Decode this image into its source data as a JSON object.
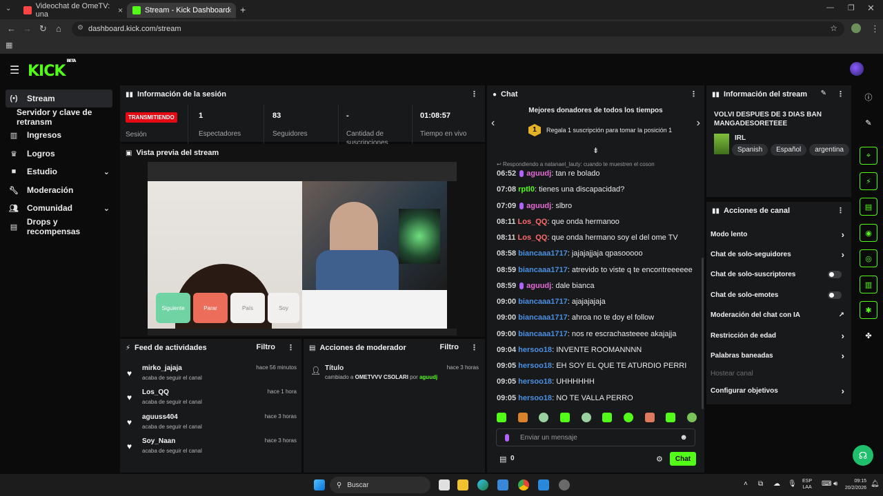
{
  "browser": {
    "tabs": [
      {
        "title": "Videochat de OmeTV: una",
        "active": false
      },
      {
        "title": "Stream - Kick Dashboard",
        "active": true
      }
    ],
    "new_tab_glyph": "+",
    "url": "dashboard.kick.com/stream"
  },
  "kick": {
    "logo": "KICK",
    "logo_badge": "BETA"
  },
  "sidebar": {
    "items": [
      {
        "label": "Stream",
        "icon": "broadcast-icon"
      },
      {
        "label": "Servidor y clave de retransm"
      },
      {
        "label": "Ingresos",
        "icon": "chart-icon"
      },
      {
        "label": "Logros",
        "icon": "trophy-icon"
      },
      {
        "label": "Estudio",
        "icon": "camera-icon"
      },
      {
        "label": "Moderación",
        "icon": "wrench-icon"
      },
      {
        "label": "Comunidad",
        "icon": "people-icon"
      },
      {
        "label": "Drops y recompensas",
        "icon": "gift-icon"
      }
    ]
  },
  "session": {
    "title": "Información de la sesión",
    "status_badge": "TRANSMITIENDO",
    "status_label": "Sesión",
    "viewers_value": "1",
    "viewers_label": "Espectadores",
    "followers_value": "83",
    "followers_label": "Seguidores",
    "subs_value": "-",
    "subs_label": "Cantidad de suscripciones",
    "live_value": "01:08:57",
    "live_label": "Tiempo en vivo"
  },
  "preview": {
    "title": "Vista previa del stream",
    "btn_next": "Siguiente",
    "btn_stop": "Parar",
    "btn_country": "País",
    "btn_soy": "Soy"
  },
  "feed": {
    "title": "Feed de actividades",
    "filter": "Filtro",
    "items": [
      {
        "name": "mirko_jajaja",
        "sub": "acaba de seguir el canal",
        "time": "hace 56 minutos"
      },
      {
        "name": "Los_QQ",
        "sub": "acaba de seguir el canal",
        "time": "hace 1 hora"
      },
      {
        "name": "aguuss404",
        "sub": "acaba de seguir el canal",
        "time": "hace 3 horas"
      },
      {
        "name": "Soy_Naan",
        "sub": "acaba de seguir el canal",
        "time": "hace 3 horas"
      }
    ]
  },
  "modactions": {
    "title": "Acciones de moderador",
    "filter": "Filtro",
    "item_title": "Título",
    "item_time": "hace 3 horas",
    "item_prefix": "cambiado a",
    "item_value": "OMETVVV CSOLARI",
    "item_by": "por",
    "item_user": "aguudj"
  },
  "chat": {
    "title": "Chat",
    "donors_title": "Mejores donadores de todos los tiempos",
    "donor_rank": "1",
    "donor_text": "Regala 1 suscripción para tomar la posición 1",
    "reply_text": "Respondiendo a natanael_lauty: cuando te muestren el coson",
    "messages": [
      {
        "time": "06:52",
        "user": "aguudj",
        "color": "#e36bd6",
        "mic": true,
        "text": "tan re bolado"
      },
      {
        "time": "07:08",
        "user": "rptl0",
        "color": "#53fc18",
        "mic": false,
        "text": "tienes una discapacidad?"
      },
      {
        "time": "07:09",
        "user": "aguudj",
        "color": "#e36bd6",
        "mic": true,
        "text": "slbro"
      },
      {
        "time": "08:11",
        "user": "Los_QQ",
        "color": "#ff6b6b",
        "mic": false,
        "text": "que onda hermanoo"
      },
      {
        "time": "08:11",
        "user": "Los_QQ",
        "color": "#ff6b6b",
        "mic": false,
        "text": "que onda hermano soy el del ome TV"
      },
      {
        "time": "08:58",
        "user": "biancaaa1717",
        "color": "#4a90e2",
        "mic": false,
        "text": "jajajajjaja qpasooooo"
      },
      {
        "time": "08:59",
        "user": "biancaaa1717",
        "color": "#4a90e2",
        "mic": false,
        "text": "atrevido to viste q te encontreeeeee"
      },
      {
        "time": "08:59",
        "user": "aguudj",
        "color": "#e36bd6",
        "mic": true,
        "text": "dale bianca"
      },
      {
        "time": "09:00",
        "user": "biancaaa1717",
        "color": "#4a90e2",
        "mic": false,
        "text": "ajajajajaja"
      },
      {
        "time": "09:00",
        "user": "biancaaa1717",
        "color": "#4a90e2",
        "mic": false,
        "text": "ahroa no te doy el follow"
      },
      {
        "time": "09:00",
        "user": "biancaaa1717",
        "color": "#4a90e2",
        "mic": false,
        "text": "nos re escrachasteeee akajajja"
      },
      {
        "time": "09:04",
        "user": "hersoo18",
        "color": "#4a90e2",
        "mic": false,
        "text": "INVENTE ROOMANNNN"
      },
      {
        "time": "09:05",
        "user": "hersoo18",
        "color": "#4a90e2",
        "mic": false,
        "text": "EH SOY EL QUE TE ATURDIO PERRI"
      },
      {
        "time": "09:05",
        "user": "hersoo18",
        "color": "#4a90e2",
        "mic": false,
        "text": "UHHHHHH"
      },
      {
        "time": "09:05",
        "user": "hersoo18",
        "color": "#4a90e2",
        "mic": false,
        "text": "NO TE VALLA PERRO"
      }
    ],
    "input_placeholder": "Enviar un mensaje",
    "points": "0",
    "send_label": "Chat"
  },
  "streaminfo": {
    "title": "Información del stream",
    "stream_title": "VOLVI DESPUES DE 3 DIAS BAN MANGADESORETEEE",
    "category": "IRL",
    "tags": [
      "Spanish",
      "Español",
      "argentina"
    ]
  },
  "channel_actions": {
    "title": "Acciones de canal",
    "items": [
      {
        "label": "Modo lento",
        "control": "arrow"
      },
      {
        "label": "Chat de solo-seguidores",
        "control": "arrow"
      },
      {
        "label": "Chat de solo-suscriptores",
        "control": "toggle"
      },
      {
        "label": "Chat de solo-emotes",
        "control": "toggle"
      },
      {
        "label": "Moderación del chat con IA",
        "control": "external"
      },
      {
        "label": "Restricción de edad",
        "control": "arrow"
      },
      {
        "label": "Palabras baneadas",
        "control": "arrow"
      },
      {
        "label": "Hostear canal",
        "control": "disabled"
      },
      {
        "label": "Configurar objetivos",
        "control": "arrow"
      }
    ]
  },
  "taskbar": {
    "search_label": "Buscar",
    "lang_top": "ESP",
    "lang_bottom": "LAA",
    "time": "09:15",
    "date": "20/2/2026"
  },
  "colors": {
    "kick_green": "#53fc18",
    "live_red": "#e50914",
    "panel_bg": "#18191b"
  }
}
